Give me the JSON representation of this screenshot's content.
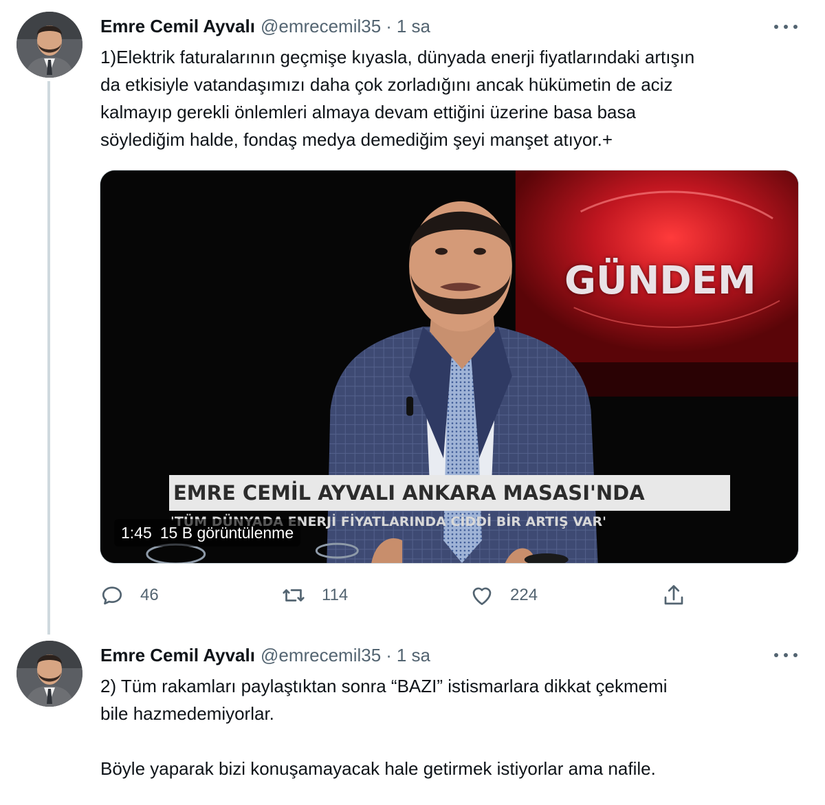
{
  "tweets": [
    {
      "author_name": "Emre Cemil Ayvalı",
      "handle": "@emrecemil35",
      "separator": "·",
      "time": "1 sa",
      "text": "1)Elektrik faturalarının geçmişe kıyasla, dünyada enerji fiyatlarındaki artışın\nda etkisiyle vatandaşımızı daha çok zorladığını ancak hükümetin de aciz\nkalmayıp gerekli önlemleri almaya devam ettiğini üzerine basa basa\nsöylediğim halde, fondaş medya demediğim şeyi manşet atıyor.+",
      "media": {
        "duration": "1:45",
        "views": "15 B görüntülenme",
        "background_text": "GÜNDEM",
        "lower_third": "EMRE CEMİL AYVALI ANKARA MASASI'NDA",
        "subcaption": "'TÜM DÜNYADA ENERJİ FİYATLARINDA CİDDİ BİR ARTIŞ VAR'"
      },
      "actions": {
        "replies": "46",
        "retweets": "114",
        "likes": "224"
      }
    },
    {
      "author_name": "Emre Cemil Ayvalı",
      "handle": "@emrecemil35",
      "separator": "·",
      "time": "1 sa",
      "text": "2) Tüm rakamları paylaştıktan sonra “BAZI” istismarlara dikkat çekmemi\nbile hazmedemiyorlar.\n\nBöyle yaparak bizi konuşamayacak hale getirmek istiyorlar ama nafile."
    }
  ],
  "icons": {
    "more": "more-horizontal-icon",
    "reply": "reply-icon",
    "retweet": "retweet-icon",
    "like": "heart-icon",
    "share": "share-icon"
  },
  "colors": {
    "text_primary": "#0f1419",
    "text_secondary": "#536471",
    "thread_line": "#cfd9de",
    "media_accent_red": "#b3111b"
  }
}
